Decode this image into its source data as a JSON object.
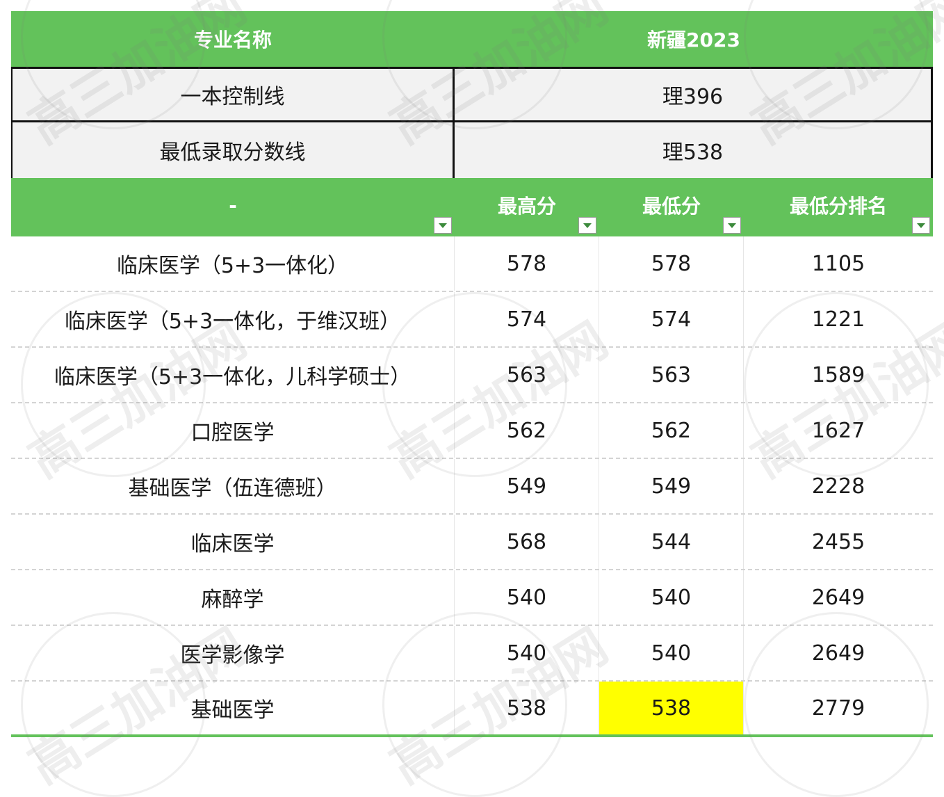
{
  "header": {
    "col1": "专业名称",
    "col2": "新疆2023"
  },
  "info_rows": [
    {
      "label": "一本控制线",
      "value": "理396"
    },
    {
      "label": "最低录取分数线",
      "value": "理538"
    }
  ],
  "sub_header": {
    "col1": "-",
    "col2": "最高分",
    "col3": "最低分",
    "col4": "最低分排名"
  },
  "rows": [
    {
      "major": "临床医学（5+3一体化）",
      "max": "578",
      "min": "578",
      "rank": "1105"
    },
    {
      "major": "临床医学（5+3一体化，于维汉班）",
      "max": "574",
      "min": "574",
      "rank": "1221"
    },
    {
      "major": "临床医学（5+3一体化，儿科学硕士）",
      "max": "563",
      "min": "563",
      "rank": "1589"
    },
    {
      "major": "口腔医学",
      "max": "562",
      "min": "562",
      "rank": "1627"
    },
    {
      "major": "基础医学（伍连德班）",
      "max": "549",
      "min": "549",
      "rank": "2228"
    },
    {
      "major": "临床医学",
      "max": "568",
      "min": "544",
      "rank": "2455"
    },
    {
      "major": "麻醉学",
      "max": "540",
      "min": "540",
      "rank": "2649"
    },
    {
      "major": "医学影像学",
      "max": "540",
      "min": "540",
      "rank": "2649"
    },
    {
      "major": "基础医学",
      "max": "538",
      "min": "538",
      "rank": "2779"
    }
  ],
  "highlight_color": "#ffff00",
  "header_color": "#63c25b",
  "watermark": "高三加油网"
}
